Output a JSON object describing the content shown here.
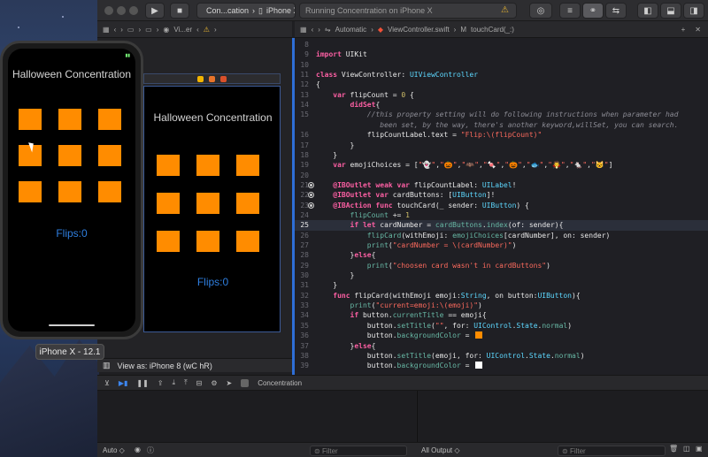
{
  "toolbar": {
    "scheme_app": "Con...cation",
    "scheme_device": "iPhone X",
    "status": "Running Concentration on iPhone X"
  },
  "ib_jumpbar": {
    "path": "Vi...er"
  },
  "editor_jumpbar": {
    "file": "ViewController.swift",
    "symbol": "touchCard(_:)",
    "group": "Automatic"
  },
  "sim": {
    "title": "Halloween Concentration",
    "flips": "Flips:0",
    "label": "iPhone X - 12.1"
  },
  "ib": {
    "title": "Halloween Concentration",
    "flips": "Flips:0",
    "view_as": "View as: iPhone 8 (wC hR)"
  },
  "code": [
    {
      "n": "8",
      "html": ""
    },
    {
      "n": "9",
      "html": "<span class='k'>import</span> UIKit"
    },
    {
      "n": "10",
      "html": ""
    },
    {
      "n": "11",
      "html": "<span class='k'>class</span> ViewController: <span class='t'>UIViewController</span>"
    },
    {
      "n": "12",
      "html": "{"
    },
    {
      "n": "13",
      "html": "    <span class='k'>var</span> flipCount = <span class='n'>0</span> {"
    },
    {
      "n": "14",
      "html": "        <span class='k'>didSet</span>{"
    },
    {
      "n": "15",
      "html": "            <span class='c'>//this property setting will do following instructions when parameter had</span>"
    },
    {
      "n": "",
      "html": "               <span class='c'>been set, by the way, there's another keyword,willSet, you can search.</span>"
    },
    {
      "n": "16",
      "html": "            flipCountLabel.text = <span class='s'>\"Flip:\\(flipCount)\"</span>"
    },
    {
      "n": "17",
      "html": "        }"
    },
    {
      "n": "18",
      "html": "    }"
    },
    {
      "n": "19",
      "html": "    <span class='k'>var</span> emojiChoices = [<span class='s'>\"👻\"</span>,<span class='s'>\"🎃\"</span>,<span class='s'>\"🦇\"</span>,<span class='s'>\"🍬\"</span>,<span class='s'>\"🎃\"</span>,<span class='s'>\"🐟\"</span>,<span class='s'>\"🧛\"</span>,<span class='s'>\"🐁\"</span>,<span class='s'>\"😺\"</span>]"
    },
    {
      "n": "20",
      "html": ""
    },
    {
      "n": "21",
      "html": "    <span class='k'>@IBOutlet weak var</span> flipCountLabel: <span class='t'>UILabel</span>!",
      "outlet": true
    },
    {
      "n": "22",
      "html": "    <span class='k'>@IBOutlet var</span> cardButtons: [<span class='t'>UIButton</span>]!",
      "outlet": true
    },
    {
      "n": "23",
      "html": "    <span class='k'>@IBAction func</span> touchCard(_ sender: <span class='t'>UIButton</span>) {",
      "outlet": true
    },
    {
      "n": "24",
      "html": "        <span class='f'>flipCount</span> += <span class='n'>1</span>"
    },
    {
      "n": "25",
      "html": "        <span class='k'>if let</span> cardNumber = <span class='f'>cardButtons</span>.<span class='f'>index</span>(of: sender){",
      "hl": true
    },
    {
      "n": "26",
      "html": "            <span class='f'>flipCard</span>(withEmoji: <span class='f'>emojiChoices</span>[cardNumber], on: sender)"
    },
    {
      "n": "27",
      "html": "            <span class='f'>print</span>(<span class='s'>\"cardNumber = \\(cardNumber)\"</span>)"
    },
    {
      "n": "28",
      "html": "        }<span class='k'>else</span>{"
    },
    {
      "n": "29",
      "html": "            <span class='f'>print</span>(<span class='s'>\"choosen card wasn't in cardButtons\"</span>)"
    },
    {
      "n": "30",
      "html": "        }"
    },
    {
      "n": "31",
      "html": "    }"
    },
    {
      "n": "32",
      "html": "    <span class='k'>func</span> flipCard(withEmoji emoji:<span class='t'>String</span>, on button:<span class='t'>UIButton</span>){"
    },
    {
      "n": "33",
      "html": "        <span class='f'>print</span>(<span class='s'>\"current=emoji:\\(emoji)\"</span>)"
    },
    {
      "n": "34",
      "html": "        <span class='k'>if</span> button.<span class='f'>currentTitle</span> == emoji{"
    },
    {
      "n": "35",
      "html": "            button.<span class='f'>setTitle</span>(<span class='s'>\"\"</span>, for: <span class='t'>UIControl</span>.<span class='t'>State</span>.<span class='f'>normal</span>)"
    },
    {
      "n": "36",
      "html": "            button.<span class='f'>backgroundColor</span> = <span class='sw' style='background:#ff8c00'></span>"
    },
    {
      "n": "37",
      "html": "        }<span class='k'>else</span>{"
    },
    {
      "n": "38",
      "html": "            button.<span class='f'>setTitle</span>(emoji, for: <span class='t'>UIControl</span>.<span class='t'>State</span>.<span class='f'>normal</span>)"
    },
    {
      "n": "39",
      "html": "            button.<span class='f'>backgroundColor</span> = <span class='sw' style='background:#ffffff'></span>"
    }
  ],
  "debug": {
    "process": "Concentration",
    "auto": "Auto ◇",
    "filter_left": "Filter",
    "output": "All Output ◇",
    "filter_right": "Filter"
  },
  "colors": {
    "card": "#ff8c00",
    "flips": "#2f7fe0",
    "accent": "#2e6ed6"
  }
}
